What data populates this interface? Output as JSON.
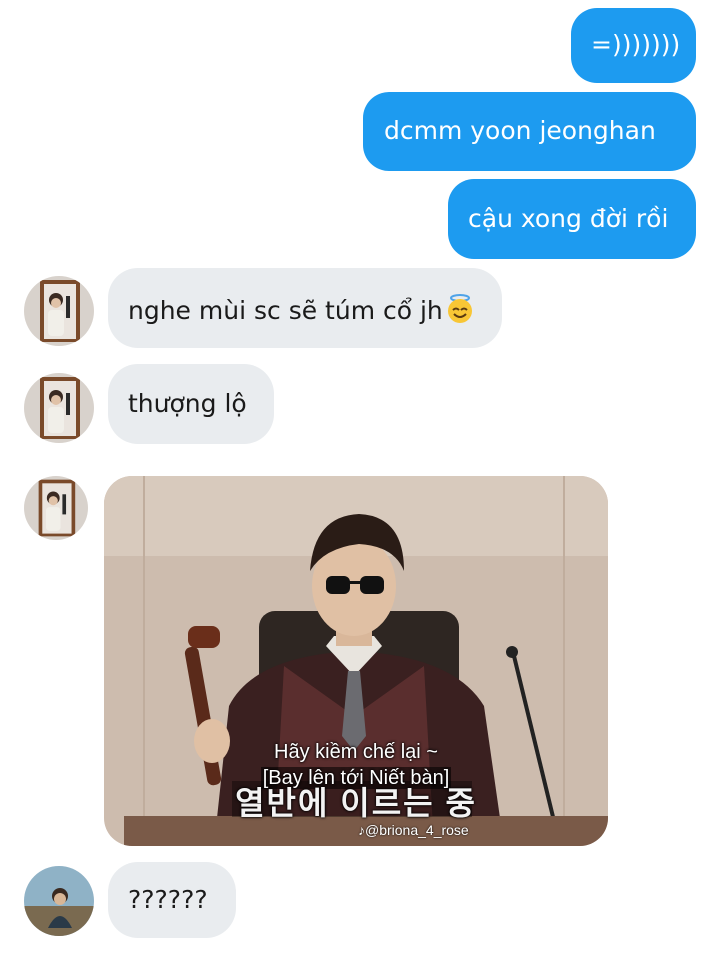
{
  "messages": [
    {
      "side": "sent",
      "text": "=)))))))"
    },
    {
      "side": "sent",
      "text": "dcmm yoon jeonghan"
    },
    {
      "side": "sent",
      "text": "cậu xong đời rồi"
    },
    {
      "side": "received",
      "text": "nghe mùi sc sẽ túm cổ jh",
      "emoji": "smiling-face-with-halo-emoji"
    },
    {
      "side": "received",
      "text": "thượng lộ"
    },
    {
      "side": "received",
      "type": "image",
      "caption_line1": "Hãy kiềm chế lại ~",
      "caption_line2": "[Bay lên tới Niết bàn]",
      "hardsub": "열반에 이르는 중",
      "watermark": "@briona_4_rose"
    },
    {
      "side": "received",
      "text": "??????"
    }
  ],
  "colors": {
    "sent_bubble": "#1d9bf0",
    "received_bubble": "#e9ecef"
  }
}
